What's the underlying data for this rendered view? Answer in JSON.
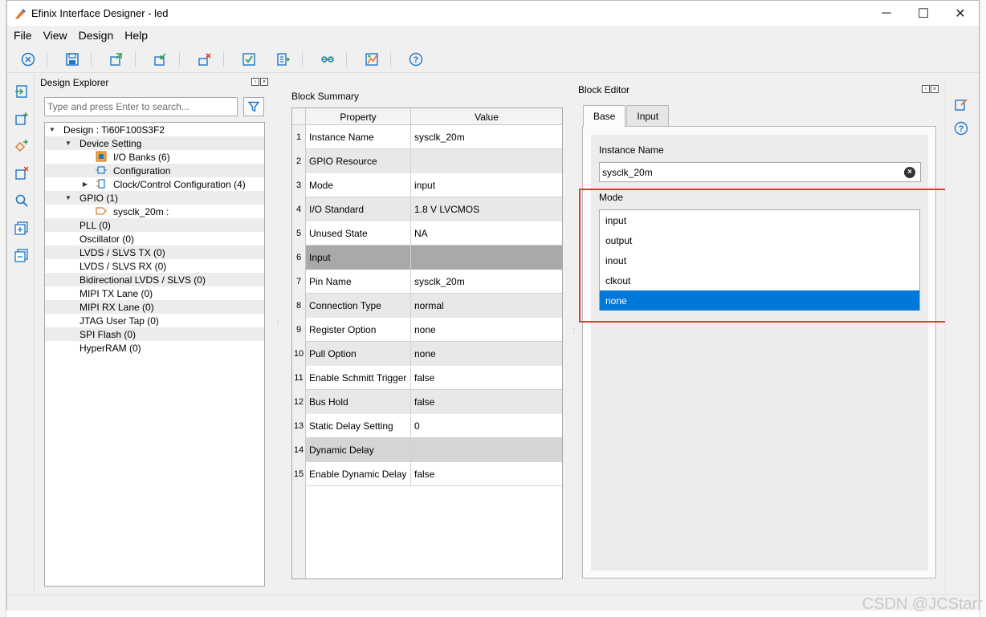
{
  "window": {
    "title": "Efinix Interface Designer - led",
    "minimize": "─",
    "maximize": "☐",
    "close": "✕"
  },
  "menu": [
    "File",
    "View",
    "Design",
    "Help"
  ],
  "toolbar": {
    "icons": [
      "close-circle-icon",
      "save-icon",
      "export-icon",
      "import-icon",
      "delete-block-icon",
      "check-icon",
      "generate-icon",
      "link-icon",
      "report-icon",
      "help-icon"
    ]
  },
  "explorer": {
    "title": "Design Explorer",
    "search_placeholder": "Type and press Enter to search...",
    "tree": [
      {
        "label": "Design : Ti60F100S3F2",
        "level": 0,
        "expanded": true
      },
      {
        "label": "Device Setting",
        "level": 1,
        "expanded": true
      },
      {
        "label": "I/O Banks (6)",
        "level": 2,
        "icon": "io-banks-icon"
      },
      {
        "label": "Configuration",
        "level": 2,
        "icon": "configuration-icon"
      },
      {
        "label": "Clock/Control Configuration (4)",
        "level": 2,
        "icon": "clock-control-icon",
        "collapsed": true
      },
      {
        "label": "GPIO (1)",
        "level": 1,
        "expanded": true
      },
      {
        "label": "sysclk_20m :",
        "level": 2,
        "icon": "gpio-pin-icon"
      },
      {
        "label": "PLL (0)",
        "level": 1
      },
      {
        "label": "Oscillator (0)",
        "level": 1
      },
      {
        "label": "LVDS / SLVS TX (0)",
        "level": 1
      },
      {
        "label": "LVDS / SLVS RX (0)",
        "level": 1
      },
      {
        "label": "Bidirectional LVDS / SLVS (0)",
        "level": 1
      },
      {
        "label": "MIPI TX Lane (0)",
        "level": 1
      },
      {
        "label": "MIPI RX Lane (0)",
        "level": 1
      },
      {
        "label": "JTAG User Tap (0)",
        "level": 1
      },
      {
        "label": "SPI Flash (0)",
        "level": 1
      },
      {
        "label": "HyperRAM (0)",
        "level": 1
      }
    ]
  },
  "summary": {
    "title": "Block Summary",
    "headers": [
      "Property",
      "Value"
    ],
    "rows": [
      {
        "num": "1",
        "property": "Instance Name",
        "value": "sysclk_20m",
        "style": ""
      },
      {
        "num": "2",
        "property": "GPIO Resource",
        "value": "",
        "style": "alt"
      },
      {
        "num": "3",
        "property": "Mode",
        "value": "input",
        "style": ""
      },
      {
        "num": "4",
        "property": "I/O Standard",
        "value": "1.8 V LVCMOS",
        "style": "alt"
      },
      {
        "num": "5",
        "property": "Unused State",
        "value": "NA",
        "style": ""
      },
      {
        "num": "6",
        "property": "Input",
        "value": "",
        "style": "section-dark"
      },
      {
        "num": "7",
        "property": "Pin Name",
        "value": "sysclk_20m",
        "style": ""
      },
      {
        "num": "8",
        "property": "Connection Type",
        "value": "normal",
        "style": "alt"
      },
      {
        "num": "9",
        "property": "Register Option",
        "value": "none",
        "style": ""
      },
      {
        "num": "10",
        "property": "Pull Option",
        "value": "none",
        "style": "alt"
      },
      {
        "num": "11",
        "property": "Enable Schmitt Trigger",
        "value": "false",
        "style": ""
      },
      {
        "num": "12",
        "property": "Bus Hold",
        "value": "false",
        "style": "alt"
      },
      {
        "num": "13",
        "property": "Static Delay Setting",
        "value": "0",
        "style": ""
      },
      {
        "num": "14",
        "property": "Dynamic Delay",
        "value": "",
        "style": "section"
      },
      {
        "num": "15",
        "property": "Enable Dynamic Delay",
        "value": "false",
        "style": ""
      }
    ]
  },
  "editor": {
    "title": "Block Editor",
    "tabs": [
      "Base",
      "Input"
    ],
    "active_tab": "Base",
    "instance_label": "Instance Name",
    "instance_value": "sysclk_20m",
    "mode_label": "Mode",
    "mode_options": [
      "input",
      "output",
      "inout",
      "clkout",
      "none"
    ],
    "mode_selected": "none"
  },
  "watermark": "CSDN @JCStarr",
  "colors": {
    "selection": "#0078d7",
    "highlight_box": "#e53935"
  }
}
